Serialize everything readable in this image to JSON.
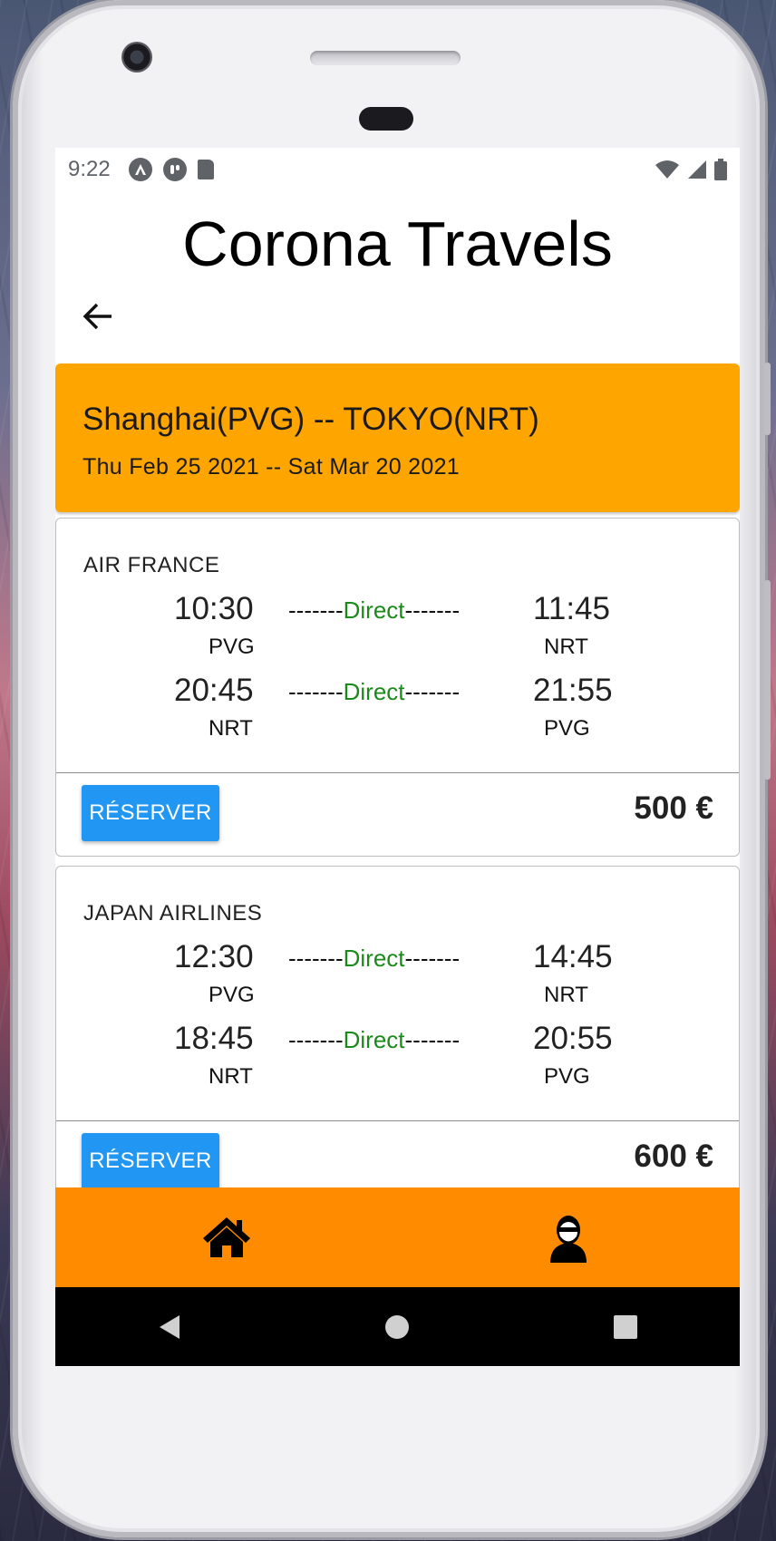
{
  "status_bar": {
    "time": "9:22"
  },
  "app": {
    "title": "Corona Travels"
  },
  "route": {
    "title": "Shanghai(PVG) -- TOKYO(NRT)",
    "dates": "Thu Feb 25 2021 -- Sat Mar 20 2021",
    "color": "#ffa500"
  },
  "flights": [
    {
      "airline": "AIR FRANCE",
      "legs": [
        {
          "dep_time": "10:30",
          "dep_airport": "PVG",
          "arr_time": "11:45",
          "arr_airport": "NRT",
          "dash_left": "-------",
          "type": "Direct",
          "dash_right": "-------"
        },
        {
          "dep_time": "20:45",
          "dep_airport": "NRT",
          "arr_time": "21:55",
          "arr_airport": "PVG",
          "dash_left": "-------",
          "type": "Direct",
          "dash_right": "-------"
        }
      ],
      "button_label": "RÉSERVER",
      "price": "500 €"
    },
    {
      "airline": "JAPAN AIRLINES",
      "legs": [
        {
          "dep_time": "12:30",
          "dep_airport": "PVG",
          "arr_time": "14:45",
          "arr_airport": "NRT",
          "dash_left": "-------",
          "type": "Direct",
          "dash_right": "-------"
        },
        {
          "dep_time": "18:45",
          "dep_airport": "NRT",
          "arr_time": "20:55",
          "arr_airport": "PVG",
          "dash_left": "-------",
          "type": "Direct",
          "dash_right": "-------"
        }
      ],
      "button_label": "RÉSERVER",
      "price": "600 €"
    }
  ],
  "bottom_nav": {
    "color": "#ff8c00",
    "items": [
      {
        "icon": "home-icon"
      },
      {
        "icon": "user-avatar-icon"
      }
    ]
  },
  "colors": {
    "reserve_button": "#2196f3",
    "direct_text": "#1a8a1a"
  }
}
